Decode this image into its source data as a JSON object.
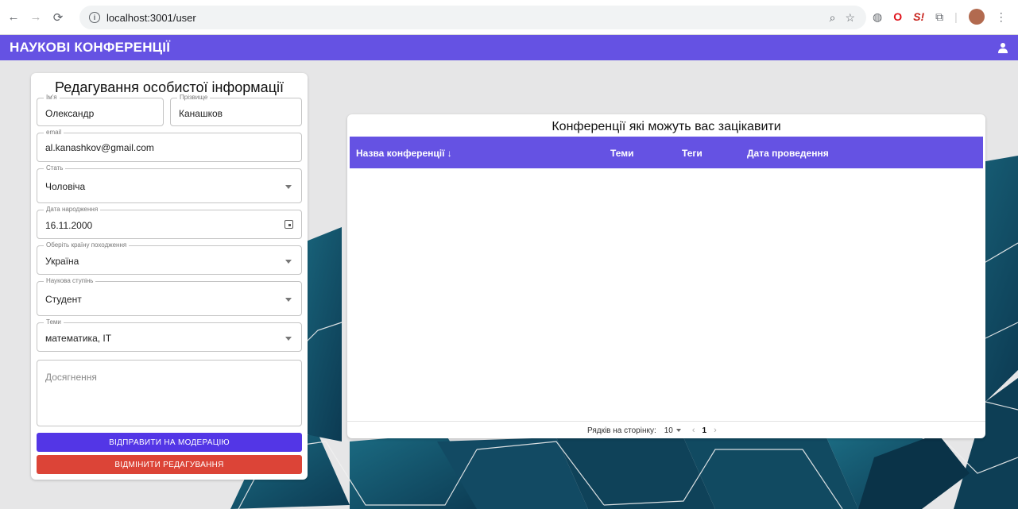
{
  "browser": {
    "url": "localhost:3001/user"
  },
  "app": {
    "title": "НАУКОВІ КОНФЕРЕНЦІЇ"
  },
  "profile_form": {
    "title": "Редагування особистої інформації",
    "first_name": {
      "label": "Ім'я",
      "value": "Олександр"
    },
    "last_name": {
      "label": "Прізвище",
      "value": "Канашков"
    },
    "email": {
      "label": "email",
      "value": "al.kanashkov@gmail.com"
    },
    "gender": {
      "label": "Стать",
      "value": "Чоловіча"
    },
    "birth_date": {
      "label": "Дата народження",
      "value": "16.11.2000"
    },
    "country": {
      "label": "Оберіть країну походження",
      "value": "Україна"
    },
    "degree": {
      "label": "Наукова ступінь",
      "value": "Студент"
    },
    "topics": {
      "label": "Теми",
      "value": "математика, IT"
    },
    "achievements": {
      "placeholder": "Досягнення"
    },
    "submit_label": "ВІДПРАВИТИ НА МОДЕРАЦІЮ",
    "cancel_label": "ВІДМІНИТИ РЕДАГУВАННЯ"
  },
  "conferences": {
    "title": "Конференції які можуть вас зацікавити",
    "columns": [
      "Назва конференції ↓",
      "Теми",
      "Теги",
      "Дата проведення"
    ],
    "rows": [],
    "rows_per_page_label": "Рядків на сторінку:",
    "rows_per_page": "10",
    "page": "1"
  },
  "colors": {
    "accent": "#6552e3",
    "submit": "#5336e6",
    "cancel": "#dc4437"
  }
}
